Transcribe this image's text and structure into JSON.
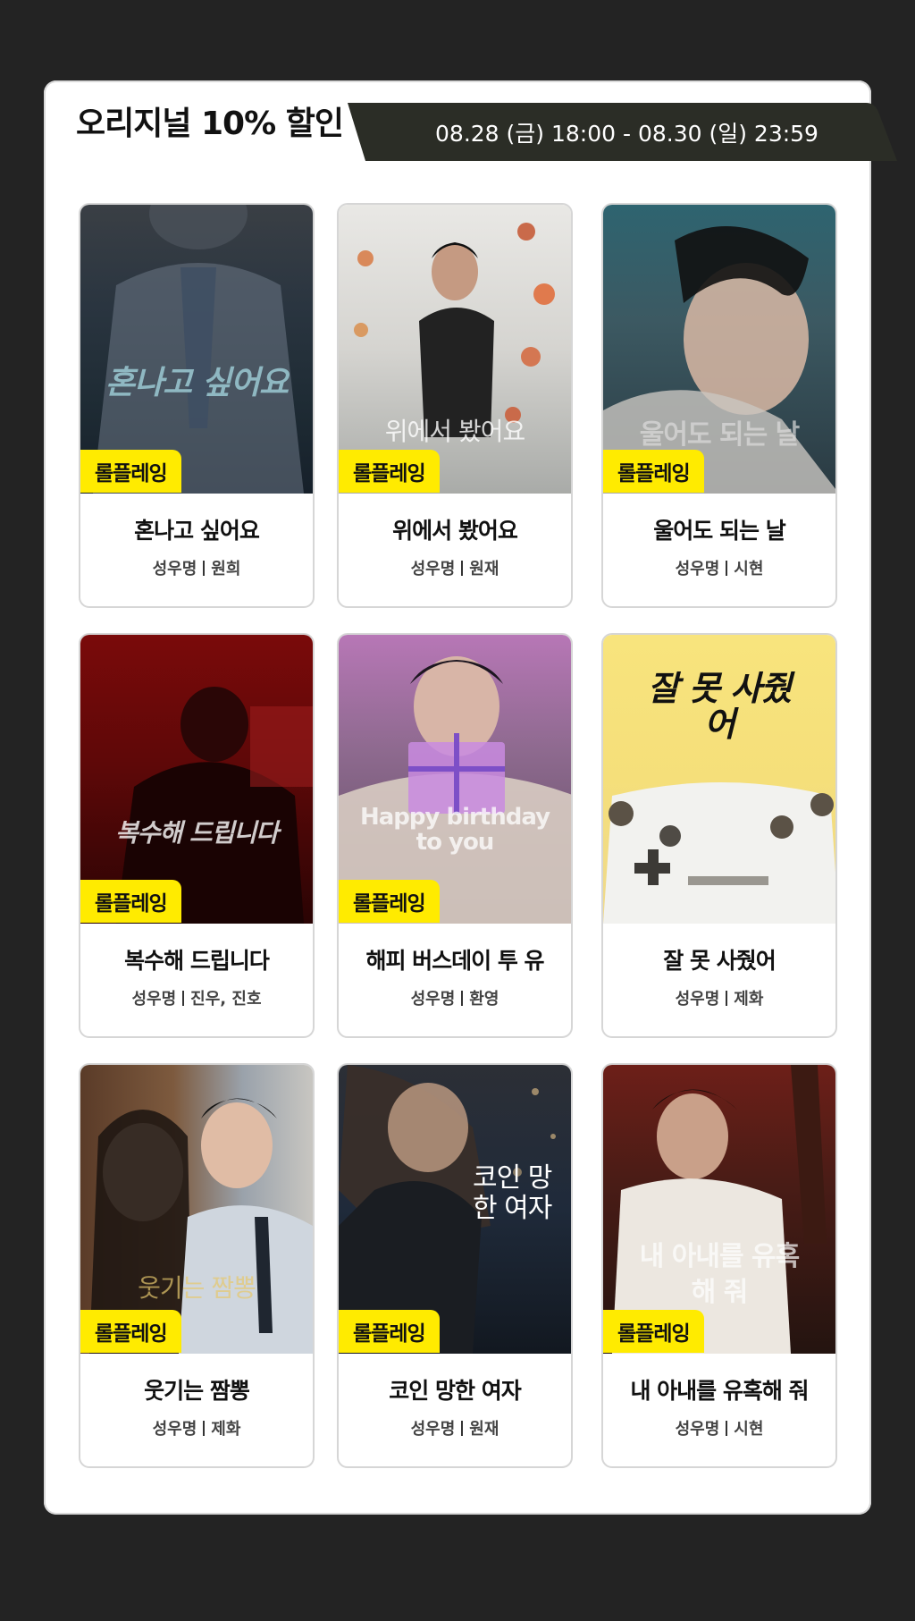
{
  "promo": {
    "title": "오리지널 10% 할인",
    "period": "08.28 (금) 18:00 - 08.30 (일) 23:59"
  },
  "cards": [
    {
      "poster_title": "혼나고 싶어요",
      "badge": "롤플레잉",
      "title": "혼나고 싶어요",
      "cast_label": "성우명",
      "cast": "원희"
    },
    {
      "poster_title": "위에서 봤어요",
      "badge": "롤플레잉",
      "title": "위에서 봤어요",
      "cast_label": "성우명",
      "cast": "원재"
    },
    {
      "poster_title": "울어도 되는 날",
      "badge": "롤플레잉",
      "title": "울어도 되는 날",
      "cast_label": "성우명",
      "cast": "시현"
    },
    {
      "poster_title": "복수해 드립니다",
      "badge": "롤플레잉",
      "title": "복수해 드립니다",
      "cast_label": "성우명",
      "cast": "진우, 진호"
    },
    {
      "poster_title": "Happy birthday to you",
      "badge": "롤플레잉",
      "title": "해피 버스데이 투 유",
      "cast_label": "성우명",
      "cast": "환영"
    },
    {
      "poster_title": "잘 못 사줬어",
      "badge": "",
      "title": "잘 못 사줬어",
      "cast_label": "성우명",
      "cast": "제화"
    },
    {
      "poster_title": "웃기는 짬뽕",
      "badge": "롤플레잉",
      "title": "웃기는 짬뽕",
      "cast_label": "성우명",
      "cast": "제화"
    },
    {
      "poster_title": "코인 망한 여자",
      "badge": "롤플레잉",
      "title": "코인 망한 여자",
      "cast_label": "성우명",
      "cast": "원재"
    },
    {
      "poster_title": "내 아내를 유혹해 줘",
      "badge": "롤플레잉",
      "title": "내 아내를 유혹해 줘",
      "cast_label": "성우명",
      "cast": "시현"
    }
  ],
  "colors": {
    "background": "#232323",
    "badge": "#ffeb00",
    "date_tab": "#2b2d26"
  }
}
